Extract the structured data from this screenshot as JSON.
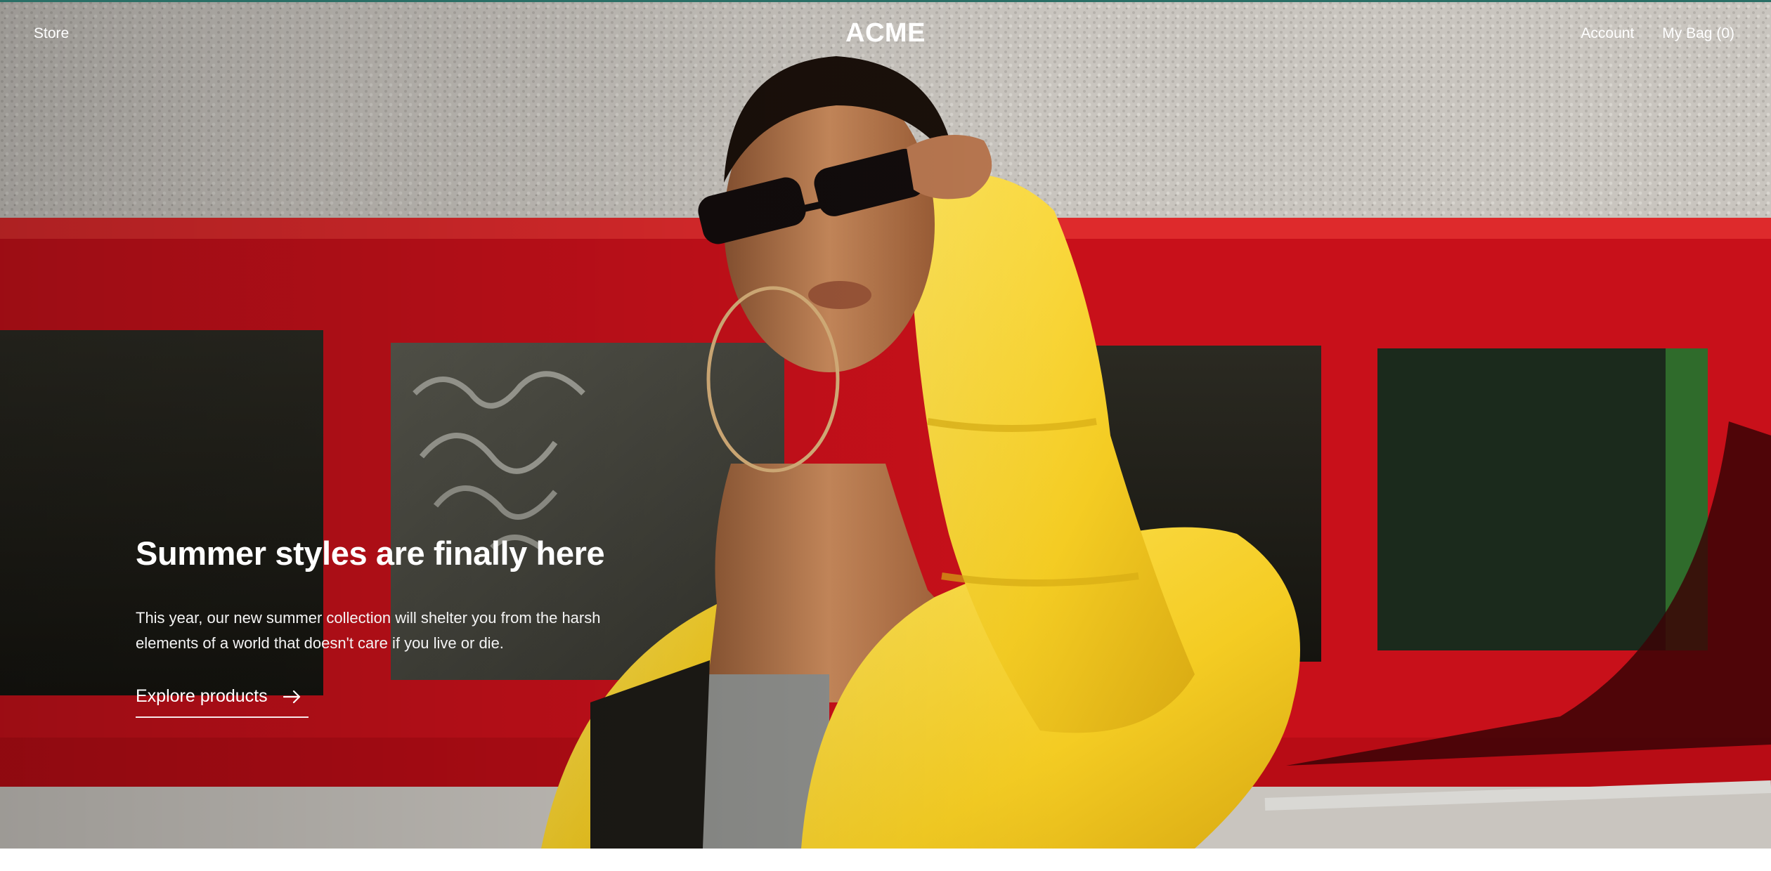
{
  "header": {
    "store_label": "Store",
    "logo": "ACME",
    "account_label": "Account",
    "bag_label": "My Bag (0)"
  },
  "hero": {
    "title": "Summer styles are finally here",
    "description": "This year, our new summer collection will shelter you from the harsh elements of a world that doesn't care if you live or die.",
    "cta_label": "Explore products",
    "cta_icon": "arrow-right-icon"
  },
  "colors": {
    "accent_rule": "#2a6f66",
    "text_on_image": "#ffffff",
    "window_frame_red": "#c8101a",
    "jacket_yellow": "#f6d22a"
  }
}
